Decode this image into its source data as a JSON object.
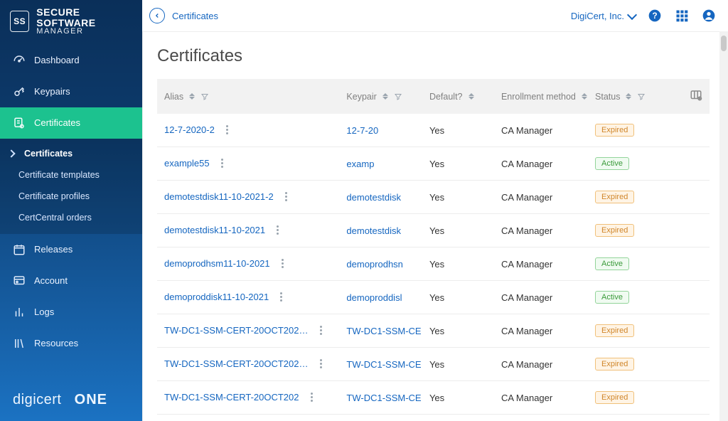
{
  "brand": {
    "badge": "SS",
    "line1": "SECURE SOFTWARE",
    "line2": "MANAGER",
    "footer_a": "digicert",
    "footer_b": "ONE"
  },
  "sidebar": {
    "items": [
      {
        "label": "Dashboard"
      },
      {
        "label": "Keypairs"
      },
      {
        "label": "Certificates"
      },
      {
        "label": "Releases"
      },
      {
        "label": "Account"
      },
      {
        "label": "Logs"
      },
      {
        "label": "Resources"
      }
    ],
    "sub": [
      {
        "label": "Certificates"
      },
      {
        "label": "Certificate templates"
      },
      {
        "label": "Certificate profiles"
      },
      {
        "label": "CertCentral orders"
      }
    ]
  },
  "topbar": {
    "breadcrumb": "Certificates",
    "org": "DigiCert, Inc."
  },
  "page": {
    "title": "Certificates"
  },
  "table": {
    "headers": {
      "alias": "Alias",
      "keypair": "Keypair",
      "def": "Default?",
      "enroll": "Enrollment method",
      "status": "Status"
    },
    "rows": [
      {
        "alias": "12-7-2020-2",
        "keypair": "12-7-20",
        "def": "Yes",
        "enroll": "CA Manager",
        "status": "Expired"
      },
      {
        "alias": "example55",
        "keypair": "examp",
        "def": "Yes",
        "enroll": "CA Manager",
        "status": "Active"
      },
      {
        "alias": "demotestdisk11-10-2021-2",
        "keypair": "demotestdisk",
        "def": "Yes",
        "enroll": "CA Manager",
        "status": "Expired"
      },
      {
        "alias": "demotestdisk11-10-2021",
        "keypair": "demotestdisk",
        "def": "Yes",
        "enroll": "CA Manager",
        "status": "Expired"
      },
      {
        "alias": "demoprodhsm11-10-2021",
        "keypair": "demoprodhsn",
        "def": "Yes",
        "enroll": "CA Manager",
        "status": "Active"
      },
      {
        "alias": "demoproddisk11-10-2021",
        "keypair": "demoproddisl",
        "def": "Yes",
        "enroll": "CA Manager",
        "status": "Active"
      },
      {
        "alias": "TW-DC1-SSM-CERT-20OCT202…",
        "keypair": "TW-DC1-SSM-CE",
        "def": "Yes",
        "enroll": "CA Manager",
        "status": "Expired"
      },
      {
        "alias": "TW-DC1-SSM-CERT-20OCT202…",
        "keypair": "TW-DC1-SSM-CE",
        "def": "Yes",
        "enroll": "CA Manager",
        "status": "Expired"
      },
      {
        "alias": "TW-DC1-SSM-CERT-20OCT202",
        "keypair": "TW-DC1-SSM-CE",
        "def": "Yes",
        "enroll": "CA Manager",
        "status": "Expired"
      }
    ]
  }
}
